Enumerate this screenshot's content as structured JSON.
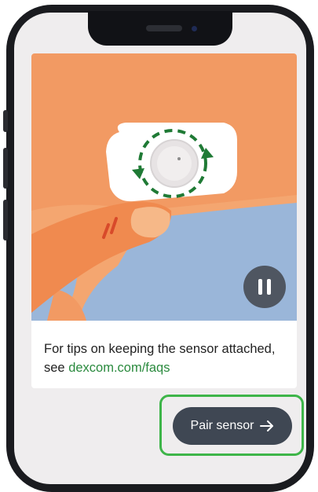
{
  "card": {
    "tip_text": "For tips on keeping the sensor attached, see ",
    "tip_link": "dexcom.com/faqs"
  },
  "actions": {
    "pair_label": "Pair sensor"
  },
  "colors": {
    "link": "#2a8a3e",
    "button": "#3f4753",
    "highlight": "#3eb549",
    "illustration_skin": "#f29a63",
    "illustration_cloth": "#9ab6d9"
  },
  "icons": {
    "pause": "pause-icon",
    "arrow": "arrow-right-icon"
  }
}
